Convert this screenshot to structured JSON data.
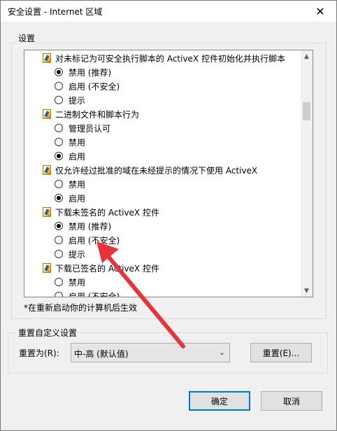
{
  "window": {
    "title": "安全设置 - Internet 区域",
    "close_glyph": "✕"
  },
  "settings_group": {
    "label": "设置",
    "items": [
      {
        "type": "header",
        "label": "对未标记为可安全执行脚本的 ActiveX 控件初始化并执行脚本"
      },
      {
        "type": "option",
        "label": "禁用 (推荐)",
        "checked": true
      },
      {
        "type": "option",
        "label": "启用 (不安全)",
        "checked": false
      },
      {
        "type": "option",
        "label": "提示",
        "checked": false
      },
      {
        "type": "header",
        "label": "二进制文件和脚本行为"
      },
      {
        "type": "option",
        "label": "管理员认可",
        "checked": false
      },
      {
        "type": "option",
        "label": "禁用",
        "checked": false
      },
      {
        "type": "option",
        "label": "启用",
        "checked": true
      },
      {
        "type": "header",
        "label": "仅允许经过批准的域在未经提示的情况下使用 ActiveX"
      },
      {
        "type": "option",
        "label": "禁用",
        "checked": false
      },
      {
        "type": "option",
        "label": "启用",
        "checked": true
      },
      {
        "type": "header",
        "label": "下载未签名的 ActiveX 控件"
      },
      {
        "type": "option",
        "label": "禁用 (推荐)",
        "checked": true
      },
      {
        "type": "option",
        "label": "启用 (不安全)",
        "checked": false
      },
      {
        "type": "option",
        "label": "提示",
        "checked": false
      },
      {
        "type": "header",
        "label": "下载已签名的 ActiveX 控件"
      },
      {
        "type": "option",
        "label": "禁用",
        "checked": false
      },
      {
        "type": "option",
        "label": "启用 (不安全)",
        "checked": false
      }
    ],
    "note": "*在重新启动你的计算机后生效"
  },
  "reset_group": {
    "label": "重置自定义设置",
    "reset_to_label": "重置为(R):",
    "selected_level": "中-高 (默认值)",
    "reset_button": "重置(E)..."
  },
  "footer": {
    "ok": "确定",
    "cancel": "取消"
  },
  "colors": {
    "accent": "#0078d7",
    "annotation_arrow": "#e8323c"
  }
}
